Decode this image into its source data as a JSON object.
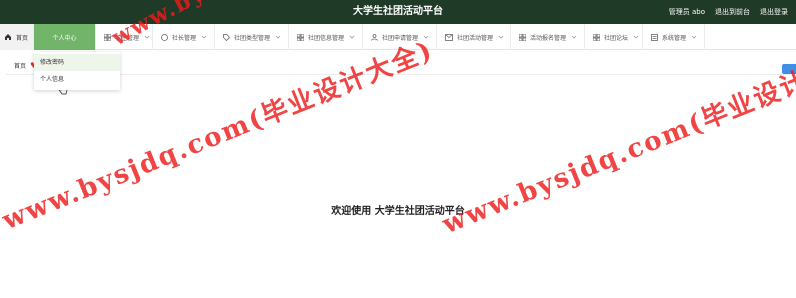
{
  "header": {
    "title": "大学生社团活动平台",
    "user": "管理员 abo",
    "front_link": "退出到前台",
    "logout_link": "退出登录"
  },
  "nav": {
    "items": [
      {
        "label": "首页",
        "icon": "home-icon"
      },
      {
        "label": "个人中心",
        "icon": "user-icon"
      },
      {
        "label": "学生管理",
        "icon": "grid-icon"
      },
      {
        "label": "社长管理",
        "icon": "circle-icon"
      },
      {
        "label": "社团类型管理",
        "icon": "tag-icon"
      },
      {
        "label": "社团信息管理",
        "icon": "grid-icon"
      },
      {
        "label": "社团申请管理",
        "icon": "person-icon"
      },
      {
        "label": "社团活动管理",
        "icon": "mail-icon"
      },
      {
        "label": "活动报名管理",
        "icon": "grid-icon"
      },
      {
        "label": "社团论坛",
        "icon": "grid-icon"
      },
      {
        "label": "系统管理",
        "icon": "list-icon"
      }
    ]
  },
  "dropdown": {
    "items": [
      "修改密码",
      "个人信息"
    ]
  },
  "breadcrumb": {
    "home": "首页"
  },
  "main": {
    "welcome": "欢迎使用 大学生社团活动平台"
  },
  "watermark": {
    "text_1": "www.bysjdq.com(毕业设计大全)",
    "text_2": "www.bysjdq.com(毕业设计大全)",
    "text_3": "www.bysjdq.com(毕业设计大全)"
  },
  "colors": {
    "header_bg": "#1f3a26",
    "active_tab": "#72b46a",
    "watermark": "#ee1c1c"
  }
}
